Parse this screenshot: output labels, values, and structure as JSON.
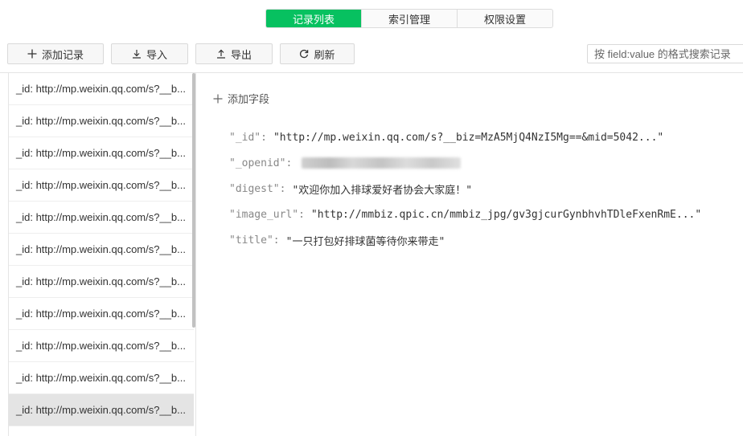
{
  "tabs": [
    {
      "label": "记录列表",
      "active": true
    },
    {
      "label": "索引管理",
      "active": false
    },
    {
      "label": "权限设置",
      "active": false
    }
  ],
  "toolbar": {
    "add_label": "添加记录",
    "import_label": "导入",
    "export_label": "导出",
    "refresh_label": "刷新",
    "search_placeholder": "按 field:value 的格式搜索记录"
  },
  "records": [
    "_id: http://mp.weixin.qq.com/s?__b...",
    "_id: http://mp.weixin.qq.com/s?__b...",
    "_id: http://mp.weixin.qq.com/s?__b...",
    "_id: http://mp.weixin.qq.com/s?__b...",
    "_id: http://mp.weixin.qq.com/s?__b...",
    "_id: http://mp.weixin.qq.com/s?__b...",
    "_id: http://mp.weixin.qq.com/s?__b...",
    "_id: http://mp.weixin.qq.com/s?__b...",
    "_id: http://mp.weixin.qq.com/s?__b...",
    "_id: http://mp.weixin.qq.com/s?__b...",
    "_id: http://mp.weixin.qq.com/s?__b..."
  ],
  "selected_index": 10,
  "detail": {
    "add_field_label": "添加字段",
    "fields": [
      {
        "key": "\"_id\":",
        "value": "\"http://mp.weixin.qq.com/s?__biz=MzA5MjQ4NzI5Mg==&mid=5042...\""
      },
      {
        "key": "\"_openid\":",
        "value": "",
        "redacted": true
      },
      {
        "key": "\"digest\":",
        "value": "\"欢迎你加入排球爱好者协会大家庭！\""
      },
      {
        "key": "\"image_url\":",
        "value": "\"http://mmbiz.qpic.cn/mmbiz_jpg/gv3gjcurGynbhvhTDleFxenRmE...\""
      },
      {
        "key": "\"title\":",
        "value": "\"一只打包好排球菌等待你来带走\""
      }
    ]
  },
  "colors": {
    "accent": "#07c160"
  }
}
